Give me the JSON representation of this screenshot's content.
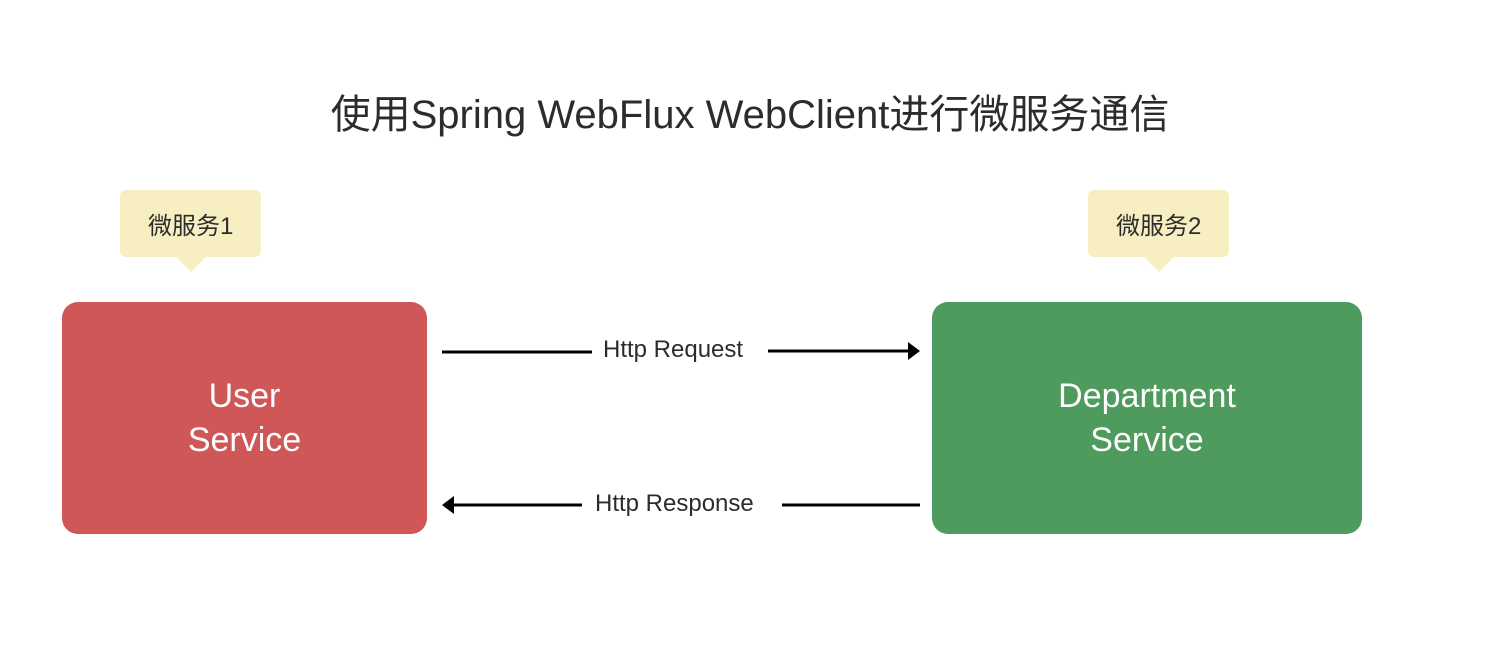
{
  "title": "使用Spring WebFlux WebClient进行微服务通信",
  "callouts": {
    "left": "微服务1",
    "right": "微服务2"
  },
  "services": {
    "left": {
      "line1": "User",
      "line2": "Service"
    },
    "right": {
      "line1": "Department",
      "line2": "Service"
    }
  },
  "arrows": {
    "request": "Http Request",
    "response": "Http Response"
  },
  "colors": {
    "left_box": "#cf5757",
    "right_box": "#4f9a5d",
    "callout_bg": "#f7efc2",
    "text": "#2c2c2c"
  }
}
